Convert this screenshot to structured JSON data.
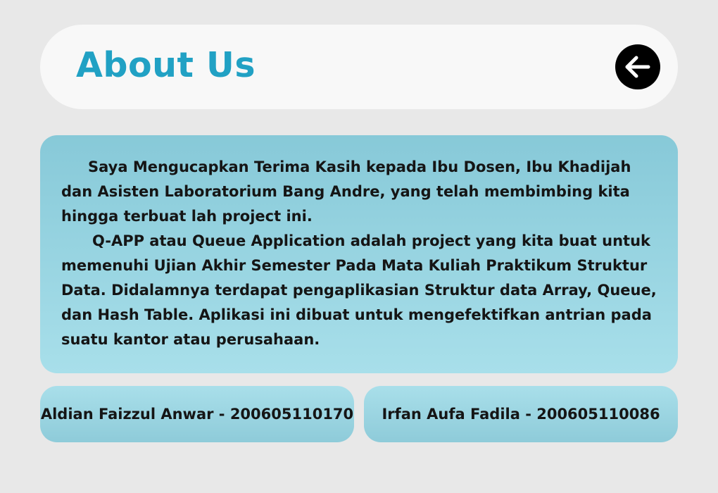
{
  "header": {
    "title": "About Us",
    "back_icon": "arrow-left-icon"
  },
  "about": {
    "paragraphs": [
      "Saya Mengucapkan Terima Kasih kepada Ibu Dosen, Ibu Khadijah dan Asisten Laboratorium Bang Andre, yang telah membimbing kita hingga terbuat lah project ini.",
      "Q-APP atau Queue Application adalah project yang kita buat untuk memenuhi Ujian Akhir Semester Pada Mata Kuliah Praktikum Struktur Data. Didalamnya terdapat pengaplikasian Struktur data Array, Queue, dan Hash Table. Aplikasi ini dibuat untuk mengefektifkan antrian pada suatu kantor atau perusahaan."
    ]
  },
  "authors": [
    {
      "label": "Aldian Faizzul Anwar - 200605110170"
    },
    {
      "label": "Irfan Aufa Fadila - 200605110086"
    }
  ],
  "colors": {
    "background": "#e8e8e8",
    "header_bg": "#f8f8f8",
    "title": "#21a1c4",
    "card_top": "#87c9d8",
    "card_bottom": "#a8dfea",
    "text": "#151515"
  }
}
